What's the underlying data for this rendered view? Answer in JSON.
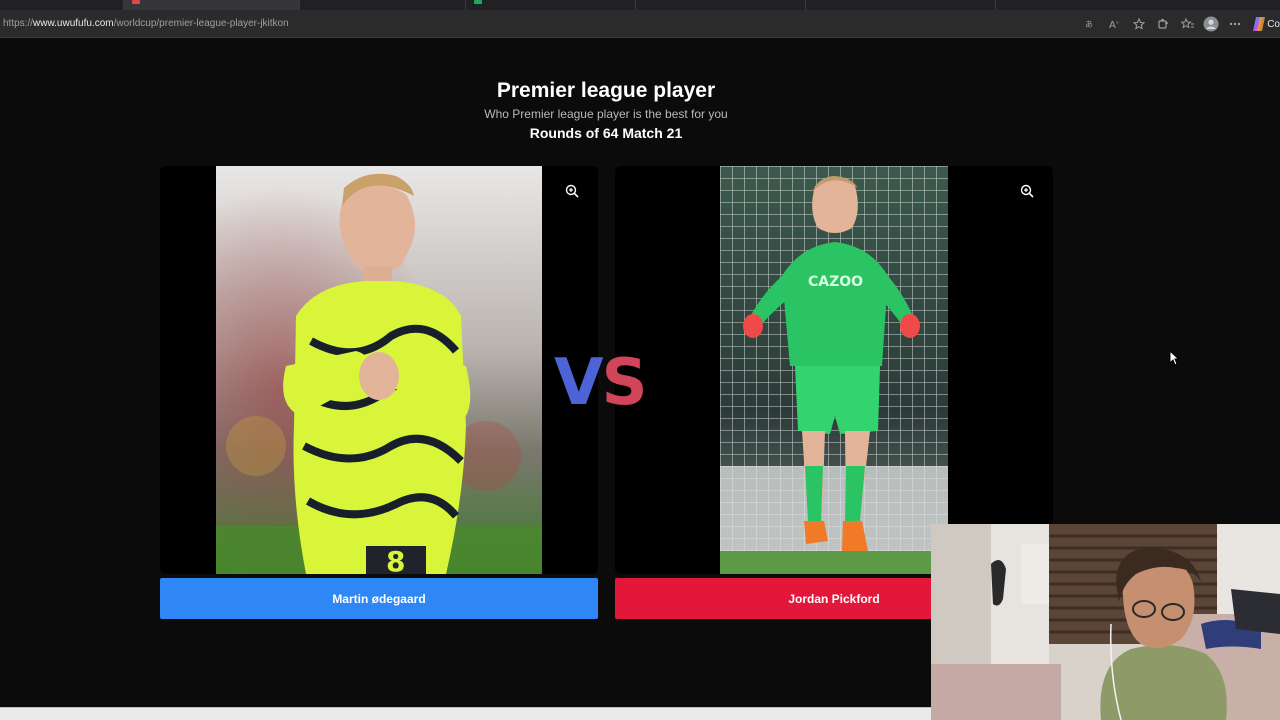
{
  "browser": {
    "url_prefix": "https://",
    "url_host": "www.uwufufu.com",
    "url_path": "/worldcup/premier-league-player-jkitkon",
    "copilot_label": "Co",
    "tool_icons": [
      "translate-icon",
      "read-aloud-icon",
      "favorite-star-icon",
      "extensions-icon",
      "favorites-icon",
      "profile-icon",
      "more-icon",
      "copilot-icon"
    ]
  },
  "game": {
    "title": "Premier league player",
    "subtitle": "Who Premier league player is the best for you",
    "round": "Rounds of 64 Match 21",
    "vs_v": "V",
    "vs_s": "S",
    "left": {
      "name": "Martin ødegaard",
      "button_color": "#2f86f5"
    },
    "right": {
      "name": "Jordan Pickford",
      "button_color": "#e3173a"
    }
  }
}
